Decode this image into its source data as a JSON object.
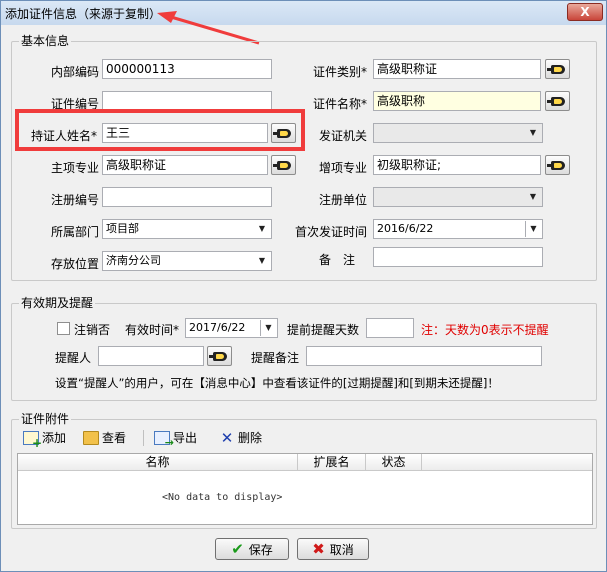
{
  "window": {
    "title": "添加证件信息（来源于复制）",
    "close_label": "X"
  },
  "basic": {
    "group_title": "基本信息",
    "internal_code": {
      "label": "内部编码",
      "value": "000000113"
    },
    "cert_no": {
      "label": "证件编号",
      "value": ""
    },
    "holder": {
      "label": "持证人姓名*",
      "value": "王三"
    },
    "main_major": {
      "label": "主项专业",
      "value": "高级职称证"
    },
    "reg_no": {
      "label": "注册编号",
      "value": ""
    },
    "department": {
      "label": "所属部门",
      "value": "项目部"
    },
    "location": {
      "label": "存放位置",
      "value": "济南分公司"
    },
    "cert_type": {
      "label": "证件类别*",
      "value": "高级职称证"
    },
    "cert_name": {
      "label": "证件名称*",
      "value": "高级职称"
    },
    "issuer": {
      "label": "发证机关",
      "value": ""
    },
    "extra_major": {
      "label": "增项专业",
      "value": "初级职称证;"
    },
    "reg_unit": {
      "label": "注册单位",
      "value": ""
    },
    "first_issue": {
      "label": "首次发证时间",
      "value": "2016/6/22"
    },
    "remark": {
      "label": "备　注",
      "value": ""
    }
  },
  "validity": {
    "group_title": "有效期及提醒",
    "cancel_label": "注销否",
    "valid_label": "有效时间*",
    "valid_value": "2017/6/22",
    "advance_label": "提前提醒天数",
    "advance_value": "",
    "note": "注：天数为0表示不提醒",
    "reminder_label": "提醒人",
    "reminder_value": "",
    "reminder_note_label": "提醒备注",
    "reminder_note_value": "",
    "info": "设置“提醒人”的用户，可在【消息中心】中查看该证件的[过期提醒]和[到期未还提醒]！"
  },
  "attachments": {
    "group_title": "证件附件",
    "toolbar": {
      "add": "添加",
      "view": "查看",
      "export": "导出",
      "delete": "删除"
    },
    "columns": [
      "名称",
      "扩展名",
      "状态"
    ],
    "empty": "<No data to display>"
  },
  "footer": {
    "save": "保存",
    "cancel": "取消"
  },
  "colors": {
    "highlight": "#f03c3c",
    "note": "#e00000",
    "required_bg": "#ffffe1"
  },
  "icons": {
    "pick": "hand-pointer-icon",
    "add": "add-file-icon",
    "view": "folder-open-icon",
    "export": "export-icon",
    "delete": "delete-x-icon",
    "save": "check-icon",
    "cancel": "cancel-x-icon"
  }
}
